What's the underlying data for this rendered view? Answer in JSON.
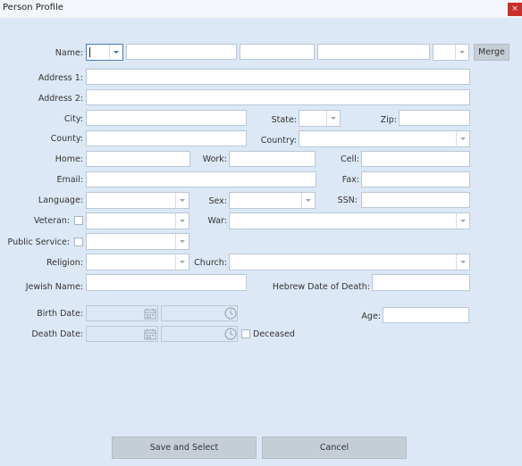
{
  "window": {
    "title": "Person Profile",
    "close": "×"
  },
  "name": {
    "label": "Name:",
    "merge": "Merge"
  },
  "address1": {
    "label": "Address 1:"
  },
  "address2": {
    "label": "Address 2:"
  },
  "city": {
    "label": "City:"
  },
  "state": {
    "label": "State:"
  },
  "zip": {
    "label": "Zip:"
  },
  "county": {
    "label": "County:"
  },
  "country": {
    "label": "Country:"
  },
  "home": {
    "label": "Home:"
  },
  "work": {
    "label": "Work:"
  },
  "cell": {
    "label": "Cell:"
  },
  "email": {
    "label": "Email:"
  },
  "fax": {
    "label": "Fax:"
  },
  "language": {
    "label": "Language:"
  },
  "sex": {
    "label": "Sex:"
  },
  "ssn": {
    "label": "SSN:"
  },
  "veteran": {
    "label": "Veteran:"
  },
  "war": {
    "label": "War:"
  },
  "public_service": {
    "label": "Public Service:"
  },
  "religion": {
    "label": "Religion:"
  },
  "church": {
    "label": "Church:"
  },
  "jewish_name": {
    "label": "Jewish Name:"
  },
  "hebrew_death": {
    "label": "Hebrew Date of Death:"
  },
  "birth": {
    "label": "Birth Date:"
  },
  "age": {
    "label": "Age:"
  },
  "death": {
    "label": "Death Date:",
    "deceased": "Deceased"
  },
  "buttons": {
    "save": "Save and Select",
    "cancel": "Cancel"
  }
}
